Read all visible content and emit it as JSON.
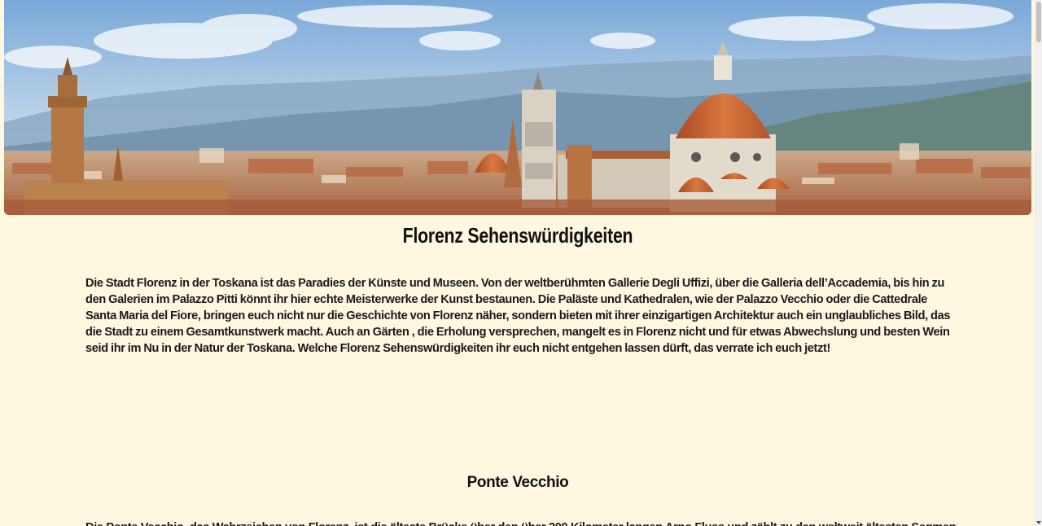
{
  "hero": {
    "image_icon": "florence-skyline-image"
  },
  "page_title": "Florenz Sehenswürdigkeiten",
  "intro_text": "Die Stadt Florenz in der Toskana ist das Paradies der Künste und Museen. Von der weltberühmten Gallerie Degli Uffizi, über die Galleria dell’Accademia, bis hin zu den Galerien im Palazzo Pitti könnt ihr hier echte Meisterwerke der Kunst bestaunen. Die Paläste und Kathedralen, wie der Palazzo Vecchio oder die Cattedrale Santa Maria del Fiore, bringen euch nicht nur die Geschichte von Florenz näher, sondern bieten mit ihrer einzigartigen Architektur auch ein unglaubliches Bild, das die Stadt zu einem Gesamtkunstwerk macht. Auch an Gärten , die Erholung versprechen, mangelt es in Florenz nicht und für etwas Abwechslung und besten Wein seid ihr im Nu in der Natur der Toskana. Welche Florenz Sehenswürdigkeiten ihr euch nicht entgehen lassen dürft, das verrate ich euch jetzt!",
  "sections": [
    {
      "title": "Ponte Vecchio",
      "text": "Die Ponte Vecchio, das Wahrzeichen von Florenz, ist die älteste Brücke über den über 200 Kilometer langen Arno Fluss und zählt zu den weltweit ältesten Segmentbogenbrücken. Der Name ist nicht zufällig gewählt"
    }
  ],
  "colors": {
    "background": "#fff8e1",
    "text": "#1a1a1a"
  }
}
